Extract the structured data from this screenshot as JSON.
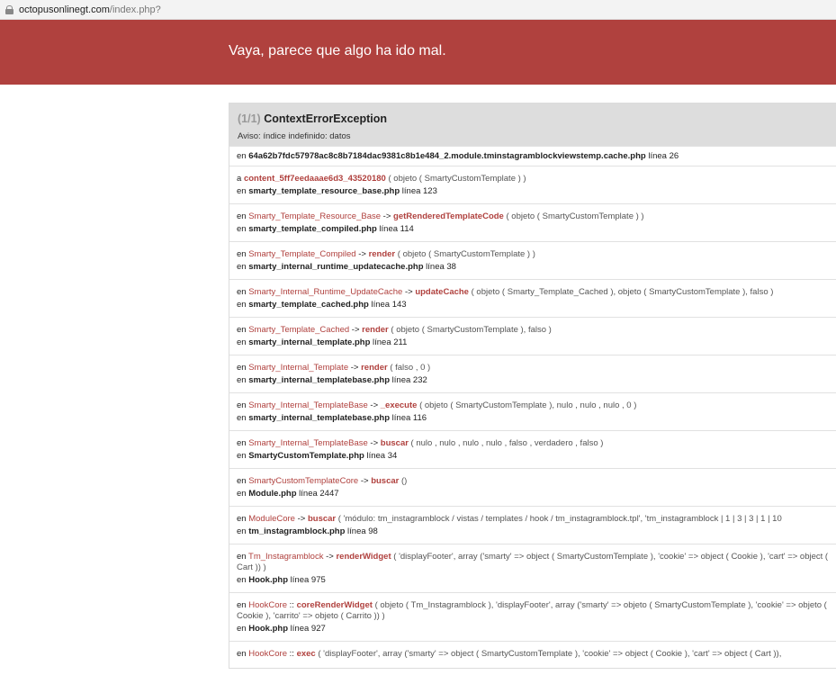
{
  "url": {
    "host": "octopusonlinegt.com",
    "path": "/index.php?"
  },
  "banner": {
    "title": "Vaya, parece que algo ha ido mal."
  },
  "exception": {
    "count": "(1/1)",
    "name": "ContextErrorException",
    "message": "Aviso: índice indefinido: datos"
  },
  "frames": [
    {
      "pre": "en",
      "file": "64a62b7fdc57978ac8c8b7184dac9381c8b1e484_2.module.tminstagramblockviewstemp.cache.php",
      "line": "línea 26"
    },
    {
      "pre": "a",
      "fn": "content_5ff7eedaaae6d3_43520180",
      "args": "( objeto ( SmartyCustomTemplate ) )",
      "file": "smarty_template_resource_base.php",
      "line": "línea 123"
    },
    {
      "pre": "en",
      "cls": "Smarty_Template_Resource_Base",
      "op": "->",
      "fn": "getRenderedTemplateCode",
      "args": "( objeto ( SmartyCustomTemplate ) )",
      "file": "smarty_template_compiled.php",
      "line": "línea 114"
    },
    {
      "pre": "en",
      "cls": "Smarty_Template_Compiled",
      "op": "->",
      "fn": "render",
      "args": "( objeto ( SmartyCustomTemplate ) )",
      "file": "smarty_internal_runtime_updatecache.php",
      "line": "línea 38"
    },
    {
      "pre": "en",
      "cls": "Smarty_Internal_Runtime_UpdateCache",
      "op": "->",
      "fn": "updateCache",
      "args": "( objeto ( Smarty_Template_Cached ), objeto ( SmartyCustomTemplate ), falso )",
      "file": "smarty_template_cached.php",
      "line": "línea 143"
    },
    {
      "pre": "en",
      "cls": "Smarty_Template_Cached",
      "op": "->",
      "fn": "render",
      "args": "( objeto ( SmartyCustomTemplate ), falso )",
      "file": "smarty_internal_template.php",
      "line": "línea 211"
    },
    {
      "pre": "en",
      "cls": "Smarty_Internal_Template",
      "op": "->",
      "fn": "render",
      "args": "( falso , 0 )",
      "file": "smarty_internal_templatebase.php",
      "line": "línea 232"
    },
    {
      "pre": "en",
      "cls": "Smarty_Internal_TemplateBase",
      "op": "->",
      "fn": "_execute",
      "args": "( objeto ( SmartyCustomTemplate ), nulo , nulo , nulo , 0 )",
      "file": "smarty_internal_templatebase.php",
      "line": "línea 116"
    },
    {
      "pre": "en",
      "cls": "Smarty_Internal_TemplateBase",
      "op": "->",
      "fn": "buscar",
      "args": "( nulo , nulo , nulo , nulo , falso , verdadero , falso )",
      "file": "SmartyCustomTemplate.php",
      "line": "línea 34"
    },
    {
      "pre": "en",
      "cls": "SmartyCustomTemplateCore",
      "op": "->",
      "fn": "buscar",
      "args": "()",
      "file": "Module.php",
      "line": "línea 2447"
    },
    {
      "pre": "en",
      "cls": "ModuleCore",
      "op": "->",
      "fn": "buscar",
      "args": "( 'módulo: tm_instagramblock / vistas / templates / hook / tm_instagramblock.tpl', 'tm_instagramblock | 1 | 3 | 3 | 1 | 10",
      "file": "tm_instagramblock.php",
      "line": "línea 98"
    },
    {
      "pre": "en",
      "cls": "Tm_Instagramblock",
      "op": "->",
      "fn": "renderWidget",
      "args": "( 'displayFooter', array ('smarty' => object ( SmartyCustomTemplate ), 'cookie' => object ( Cookie ), 'cart' => object ( Cart )) )",
      "file": "Hook.php",
      "line": "línea 975"
    },
    {
      "pre": "en",
      "cls": "HookCore",
      "op": "::",
      "fn": "coreRenderWidget",
      "args": "( objeto ( Tm_Instagramblock ), 'displayFooter', array ('smarty' => objeto ( SmartyCustomTemplate ), 'cookie' => objeto ( Cookie ), 'carrito' => objeto ( Carrito )) )",
      "file": "Hook.php",
      "line": "línea 927"
    },
    {
      "pre": "en",
      "cls": "HookCore",
      "op": "::",
      "fn": "exec",
      "args": "( 'displayFooter', array ('smarty' => object ( SmartyCustomTemplate ), 'cookie' => object ( Cookie ), 'cart' => object ( Cart )),",
      "file": "",
      "line": ""
    }
  ],
  "colors": {
    "banner": "#b0413e",
    "accent": "#b0413e",
    "header_bg": "#dddddd"
  }
}
